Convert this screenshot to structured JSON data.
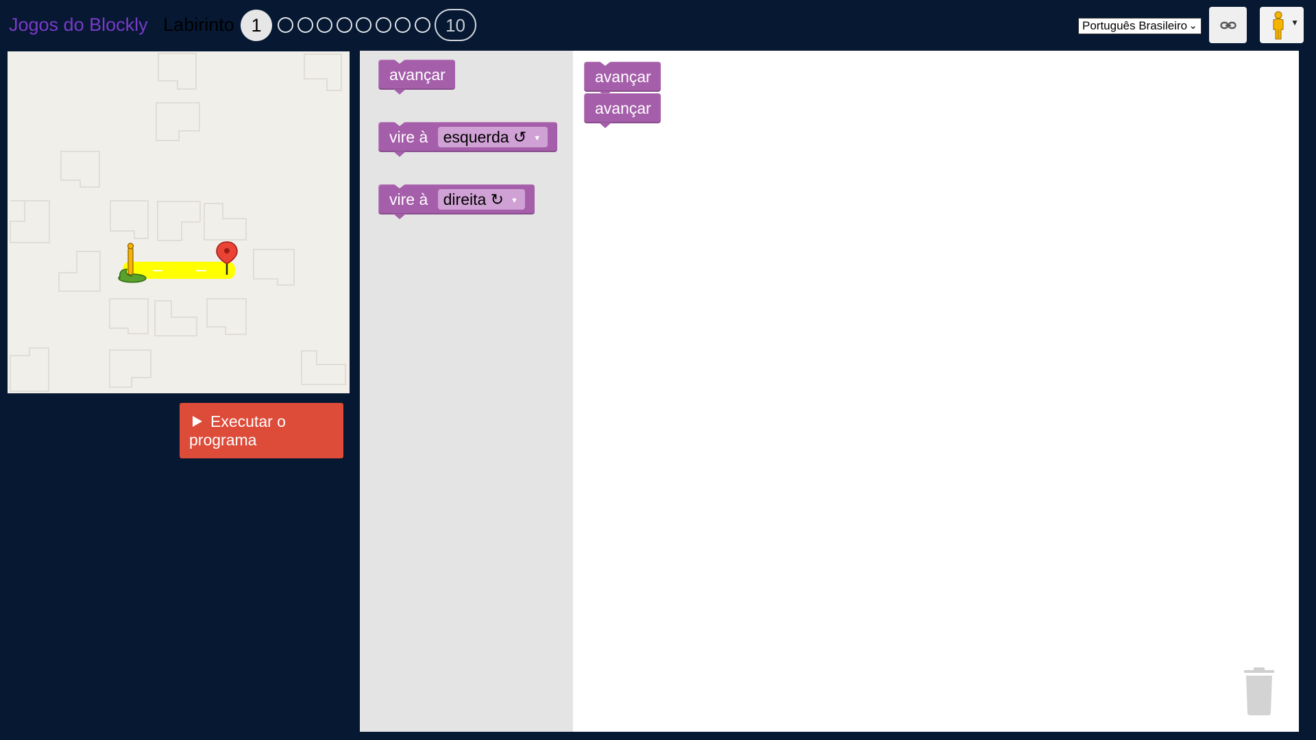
{
  "header": {
    "app_title": "Jogos do Blockly",
    "separator": ":",
    "game_name": "Labirinto",
    "levels": {
      "current": "1",
      "last": "10",
      "dot_count": 8
    },
    "language": "Português Brasileiro",
    "link_button_icon": "link-icon",
    "pegman_button_icon": "pegman-icon"
  },
  "run_button": {
    "label": "Executar o programa",
    "icon": "play-icon"
  },
  "toolbox": {
    "blocks": [
      {
        "text": "avançar"
      },
      {
        "text": "vire à",
        "dropdown": "esquerda ↺"
      },
      {
        "text": "vire à",
        "dropdown": "direita ↻"
      }
    ]
  },
  "workspace": {
    "blocks": [
      {
        "text": "avançar"
      },
      {
        "text": "avançar"
      }
    ],
    "trash_icon": "trash-icon"
  },
  "colors": {
    "background": "#061832",
    "block": "#a55eaa",
    "run_button": "#dd4b39",
    "path": "#ffff00"
  }
}
